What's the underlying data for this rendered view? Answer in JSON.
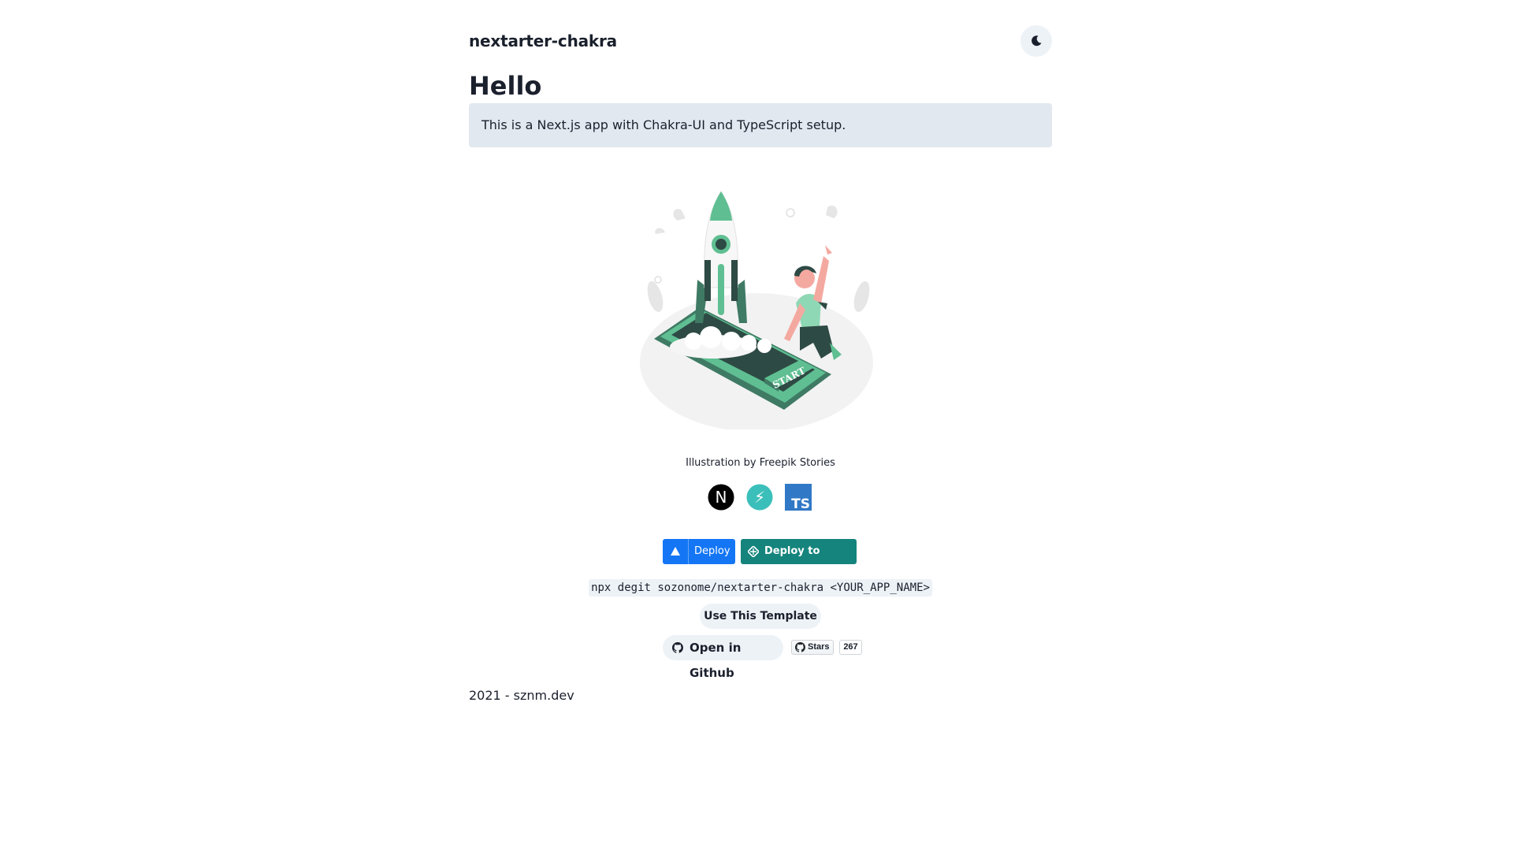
{
  "header": {
    "title": "nextarter-chakra",
    "theme_toggle_icon": "moon-icon"
  },
  "main": {
    "heading": "Hello",
    "intro": "This is a Next.js app with Chakra-UI and TypeScript setup.",
    "illustration": {
      "badge_text": "START",
      "credit": "Illustration by Freepik Stories"
    },
    "tech_icons": [
      {
        "name": "nextjs-icon",
        "glyph": "N"
      },
      {
        "name": "chakra-icon",
        "glyph": "⚡"
      },
      {
        "name": "typescript-icon",
        "glyph": "TS"
      }
    ],
    "deploy": {
      "vercel_label": "Deploy",
      "netlify_label": "Deploy to Netlify"
    },
    "command": "npx degit sozonome/nextarter-chakra <YOUR_APP_NAME>",
    "use_template_label": "Use This Template",
    "open_github_label": "Open in Github",
    "github_stars": {
      "label": "Stars",
      "count": "267"
    }
  },
  "footer": {
    "text": "2021 - sznm.dev"
  },
  "colors": {
    "text": "#1a202c",
    "intro_bg": "#e2e8f0",
    "button_bg": "#edf2f7",
    "vercel_blue": "#1476f5",
    "netlify_teal": "#15847d",
    "illustration_green": "#5fbf92"
  }
}
